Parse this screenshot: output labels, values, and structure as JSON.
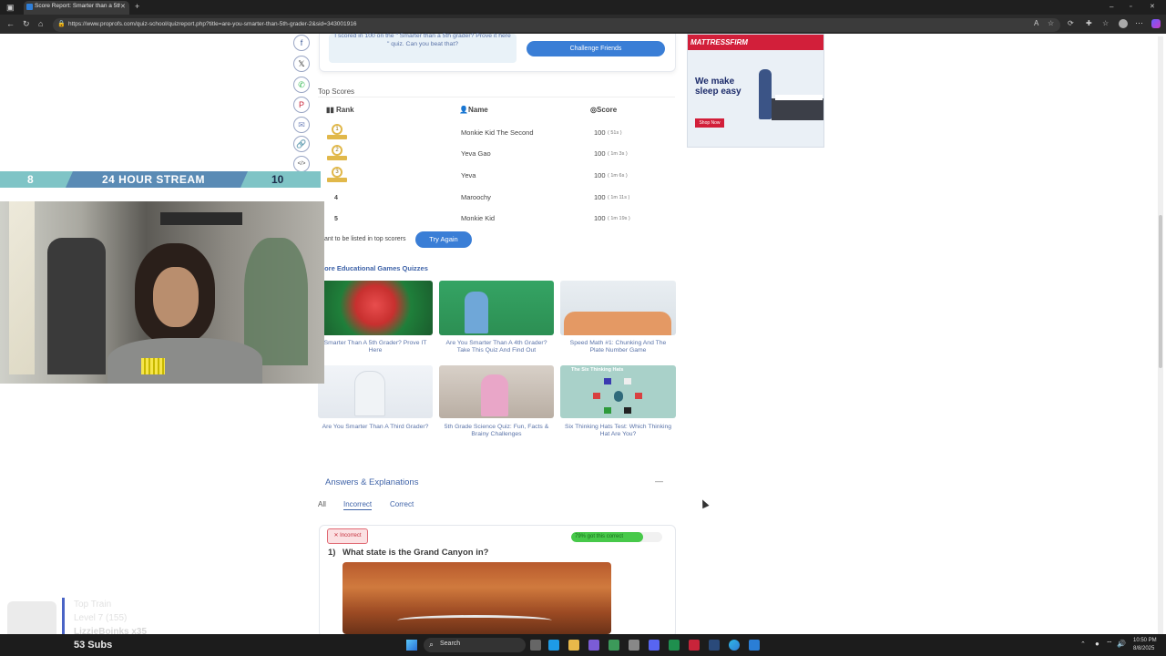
{
  "browser": {
    "tab_title": "Score Report: Smarter than a 5th",
    "url": "https://www.proprofs.com/quiz-school/quizreport.php?title=are-you-smarter-than-5th-grader-2&sid=343001916"
  },
  "share_text": "I scored in 100 on the \" Smarter than a 5th grader? Prove it here \" quiz. Can you beat that?",
  "challenge_label": "Challenge Friends",
  "ad": {
    "brand": "MATTRESSFIRM",
    "headline": "We make sleep easy",
    "cta": "Shop Now"
  },
  "top_scores": {
    "title": "Top Scores",
    "headers": [
      "Rank",
      "Name",
      "Score"
    ],
    "rows": [
      {
        "rank": "1",
        "name": "Monkie Kid The Second",
        "score": "100",
        "time": "( 51s )"
      },
      {
        "rank": "2",
        "name": "Yeva Gao",
        "score": "100",
        "time": "( 1m 3s )"
      },
      {
        "rank": "3",
        "name": "Yeva",
        "score": "100",
        "time": "( 1m 6s )"
      },
      {
        "rank": "4",
        "name": "Maroochy",
        "score": "100",
        "time": "( 1m 11s )"
      },
      {
        "rank": "5",
        "name": "Monkie Kid",
        "score": "100",
        "time": "( 1m 19s )"
      }
    ]
  },
  "want_text": "ant to be listed in top scorers",
  "try_again": "Try Again",
  "more_title": "lore Educational Games Quizzes",
  "cards": [
    {
      "title": "Smarter Than A 5th Grader? Prove IT Here"
    },
    {
      "title": "Are You Smarter Than A 4th Grader? Take This Quiz And Find Out"
    },
    {
      "title": "Speed Math #1: Chunking And The Plate Number Game"
    },
    {
      "title": "Are You Smarter Than A Third Grader?"
    },
    {
      "title": "5th Grade Science Quiz: Fun, Facts & Brainy Challenges"
    },
    {
      "title": "Six Thinking Hats Test: Which Thinking Hat Are You?",
      "img_caption": "The Six Thinking Hats"
    }
  ],
  "answers": {
    "title": "Answers & Explanations",
    "collapse": "—",
    "filters": [
      "All",
      "Incorrect",
      "Correct"
    ]
  },
  "question": {
    "badge": "✕ Incorrect",
    "pct": "79% got this correct",
    "pct_value": 79,
    "num": "1)",
    "text": "What state is the Grand Canyon in?"
  },
  "stream": {
    "left": "8",
    "title": "24 HOUR STREAM",
    "right": "10"
  },
  "overlay": {
    "label": "Top Train",
    "level": "Level 7  (155)",
    "user": "LizzieBoinks x35",
    "subs": "53 Subs"
  },
  "taskbar": {
    "search": "Search",
    "time": "10:50 PM",
    "date": "8/8/2025"
  }
}
